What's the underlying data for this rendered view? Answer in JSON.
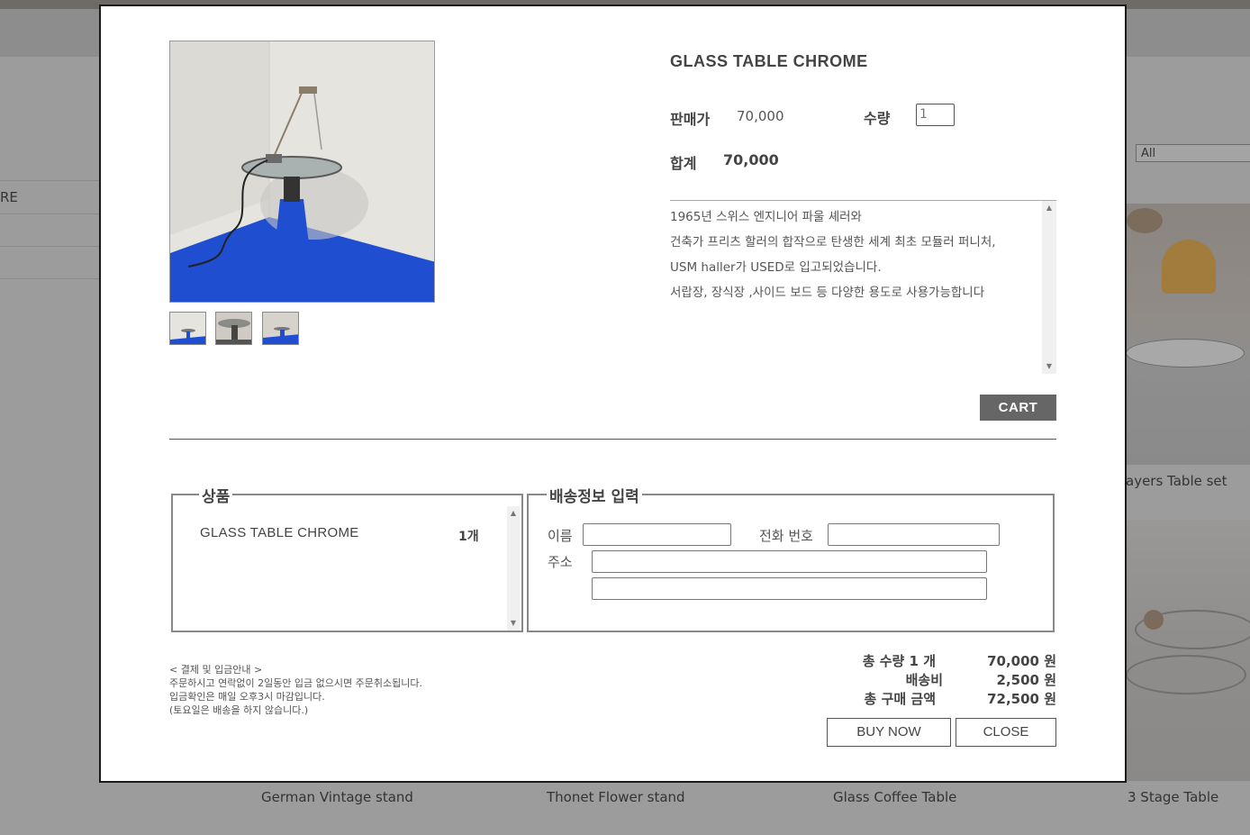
{
  "background": {
    "sidebar_items": [
      "RE",
      "",
      ""
    ],
    "filter_select": "All",
    "product_captions": [
      "German Vintage stand",
      "Thonet Flower stand",
      "Glass Coffee Table",
      "3 Stage Table"
    ],
    "right_caption_partial": "ayers Table set"
  },
  "product": {
    "title": "GLASS TABLE CHROME",
    "price_label": "판매가",
    "price": "70,000",
    "qty_label": "수량",
    "qty_value": "1",
    "total_label": "합계",
    "total": "70,000",
    "description": [
      "1965년 스위스 엔지니어 파울 셰러와",
      "건축가 프리츠 할러의 합작으로 탄생한 세계 최초 모듈러 퍼니처,",
      "USM haller가 USED로 입고되었습니다.",
      "서랍장, 장식장 ,사이드 보드 등 다양한 용도로 사용가능합니다"
    ],
    "cart_label": "CART",
    "thumbnail_count": 3
  },
  "order": {
    "items_legend": "상품",
    "items": [
      {
        "name": "GLASS TABLE CHROME",
        "qty": "1개"
      }
    ],
    "shipping_legend": "배송정보 입력",
    "name_label": "이름",
    "phone_label": "전화 번호",
    "address_label": "주소"
  },
  "notice": [
    "< 결제 및 입금안내 >",
    "주문하시고 연락없이 2일동안 입금 없으시면 주문취소됩니다.",
    "입금확인은 매일 오후3시 마감입니다.",
    "(토요일은 배송을 하지 않습니다.)"
  ],
  "summary": {
    "qty_label": "총 수량 1 개",
    "qty_amount": "70,000 원",
    "shipping_label": "배송비",
    "shipping_amount": "2,500 원",
    "total_label": "총 구매 금액",
    "total_amount": "72,500 원"
  },
  "buttons": {
    "buy_now": "BUY NOW",
    "close": "CLOSE"
  },
  "colors": {
    "accent_button": "#666666",
    "overlay": "#9c9c9c"
  }
}
